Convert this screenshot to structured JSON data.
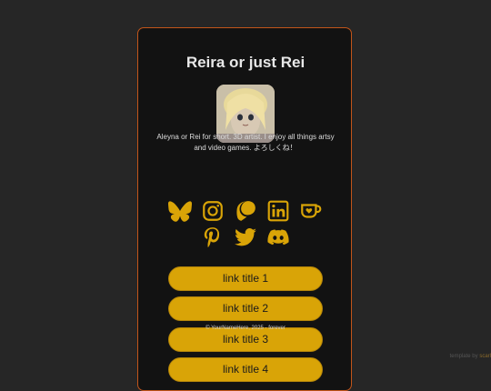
{
  "profile": {
    "name": "Reira or just Rei",
    "bio": "Aleyna or Rei for short. 3D artist. I enjoy all things artsy and video games. よろしくね！"
  },
  "social_icons": [
    "bluesky-icon",
    "instagram-icon",
    "patreon-icon",
    "linkedin-icon",
    "kofi-icon",
    "pinterest-icon",
    "twitter-icon",
    "discord-icon"
  ],
  "links": [
    "link title 1",
    "link title 2",
    "link title 3",
    "link title 4"
  ],
  "footer": "© YourNameHere, 2025 - forever",
  "credit": {
    "prefix": "template by",
    "link": "scarl"
  },
  "colors": {
    "accent": "#d9a407",
    "border": "#c2551a",
    "card": "#121212",
    "background": "#262626"
  }
}
